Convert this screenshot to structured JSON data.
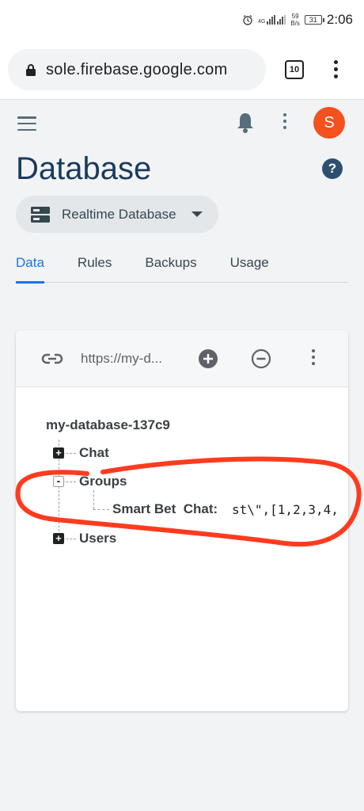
{
  "status_bar": {
    "time": "2:06",
    "network_type": "4G",
    "net_speed_value": "59",
    "net_speed_unit": "B/s",
    "battery": "31"
  },
  "browser": {
    "url": "sole.firebase.google.com",
    "tab_count": "10"
  },
  "header": {
    "avatar_letter": "S",
    "title": "Database",
    "help_symbol": "?",
    "database_selector": "Realtime Database"
  },
  "tabs": [
    {
      "label": "Data",
      "active": true
    },
    {
      "label": "Rules",
      "active": false
    },
    {
      "label": "Backups",
      "active": false
    },
    {
      "label": "Usage",
      "active": false
    }
  ],
  "data_panel": {
    "db_url": "https://my-d...",
    "root": "my-database-137c9",
    "nodes": {
      "chat": "Chat",
      "groups": "Groups",
      "users": "Users"
    },
    "groups_child": {
      "key": "Smart Bet  Chat:",
      "value": "st\\\",[1,2,3,4,"
    }
  },
  "colors": {
    "accent": "#1a73e8",
    "avatar": "#f4511e",
    "title": "#1a3a5c",
    "annotation": "#ff3b1f"
  }
}
